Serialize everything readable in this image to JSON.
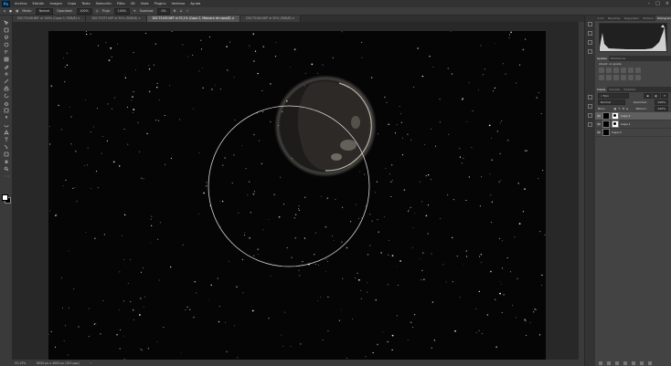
{
  "app": {
    "logo": "Ps"
  },
  "menu": [
    "Archivo",
    "Edición",
    "Imagen",
    "Capa",
    "Texto",
    "Selección",
    "Filtro",
    "3D",
    "Vista",
    "Plugins",
    "Ventana",
    "Ayuda"
  ],
  "options": {
    "mode_label": "Modo:",
    "mode_value": "Normal",
    "opacity_label": "Opacidad:",
    "opacity_value": "100%",
    "flow_label": "Flujo:",
    "flow_value": "100%",
    "smooth_label": "Suavizar:",
    "smooth_value": "0%"
  },
  "tabs": [
    {
      "label": "DSC75246.NEF al 100% (Capa 0, RGB/8)",
      "active": false
    },
    {
      "label": "DSC75337.NEF al 50% (RGB/8)",
      "active": false
    },
    {
      "label": "DSC75183.NEF al 53,1% (Capa 2, Máscara de capa/8)",
      "active": true
    },
    {
      "label": "DSC75184.NEF al 50% (RGB/8)",
      "active": false
    }
  ],
  "status": {
    "zoom": "53,13%",
    "doc": "6000 px x 4000 px (300 ppp)"
  },
  "panels": {
    "top_tabs": [
      "Color",
      "Muestras",
      "Degradado",
      "Motivos",
      "Histograma"
    ],
    "top_active": "Histograma",
    "mid_tabs": [
      "Ajustes",
      "Bibliotecas"
    ],
    "adjust_label": "Añadir un ajuste",
    "layer_tabs": [
      "Capas",
      "Canales",
      "Trazados"
    ],
    "filter_label": "Tipo",
    "blend_value": "Normal",
    "opacity_label": "Opacidad:",
    "opacity_value": "100%",
    "lock_label": "Bloq.:",
    "fill_label": "Relleno:",
    "fill_value": "100%",
    "layers": [
      {
        "name": "Capa 2",
        "selected": true,
        "mask": true
      },
      {
        "name": "Capa 1",
        "selected": false,
        "mask": true
      },
      {
        "name": "Capa 0",
        "selected": false,
        "mask": false
      }
    ]
  }
}
